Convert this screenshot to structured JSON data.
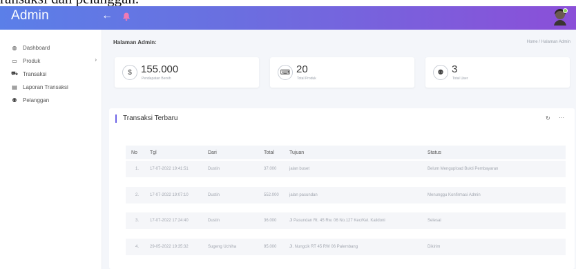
{
  "caption": "ransaksi dan pelanggan.",
  "header": {
    "brand": "Admin",
    "back_icon": "arrow-left-icon",
    "notify_icon": "bell-icon",
    "avatar_icon": "user-avatar"
  },
  "sidebar": {
    "items": [
      {
        "label": "Dashboard",
        "icon": "dashboard-icon",
        "glyph": "◍"
      },
      {
        "label": "Produk",
        "icon": "laptop-icon",
        "glyph": "▭",
        "chevron": "›"
      },
      {
        "label": "Transaksi",
        "icon": "cart-icon",
        "glyph": "⛟"
      },
      {
        "label": "Laporan Transaksi",
        "icon": "list-icon",
        "glyph": "▤"
      },
      {
        "label": "Pelanggan",
        "icon": "users-icon",
        "glyph": "⚉"
      }
    ]
  },
  "page": {
    "title": "Halaman Admin:",
    "breadcrumb": "Home  /  Halaman Admin"
  },
  "stats": [
    {
      "value": "155.000",
      "label": "Pendapatan Bersih",
      "icon": "dollar-icon",
      "glyph": "$"
    },
    {
      "value": "20",
      "label": "Total Produk",
      "icon": "keyboard-icon",
      "glyph": "⌨"
    },
    {
      "value": "3",
      "label": "Total User",
      "icon": "users-icon",
      "glyph": "⚉"
    }
  ],
  "panel": {
    "title": "Transaksi Terbaru",
    "refresh_glyph": "↻",
    "more_glyph": "···"
  },
  "table": {
    "headers": [
      "No",
      "Tgl",
      "Dari",
      "Total",
      "Tujuan",
      "Status"
    ],
    "rows": [
      [
        "1.",
        "17-07-2022 19:41:51",
        "Dustin",
        "37.000",
        "jalan buset",
        "Belum Mengupload Bukti Pembayaran"
      ],
      [
        "2.",
        "17-07-2022 19:07:10",
        "Dustin",
        "552.000",
        "jalan pasundan",
        "Menunggu Konfirmasi Admin"
      ],
      [
        "3.",
        "17-07-2022 17:24:40",
        "Dustin",
        "36.000",
        "Jl Pasundan Rt. 45 Rw. 06 No.127 Kec/Kel. Kalidoni",
        "Selesai"
      ],
      [
        "4.",
        "29-05-2022 19:35:32",
        "Sugeng Uchiha",
        "95.000",
        "Jl. Nungcik RT 45 RW 06 Palembang",
        "Dikirim"
      ]
    ]
  },
  "colors": {
    "header_gradient_start": "#5b7fe8",
    "header_gradient_end": "#8b4fd8",
    "accent": "#6c63e6",
    "page_bg": "#f4f6fa"
  }
}
